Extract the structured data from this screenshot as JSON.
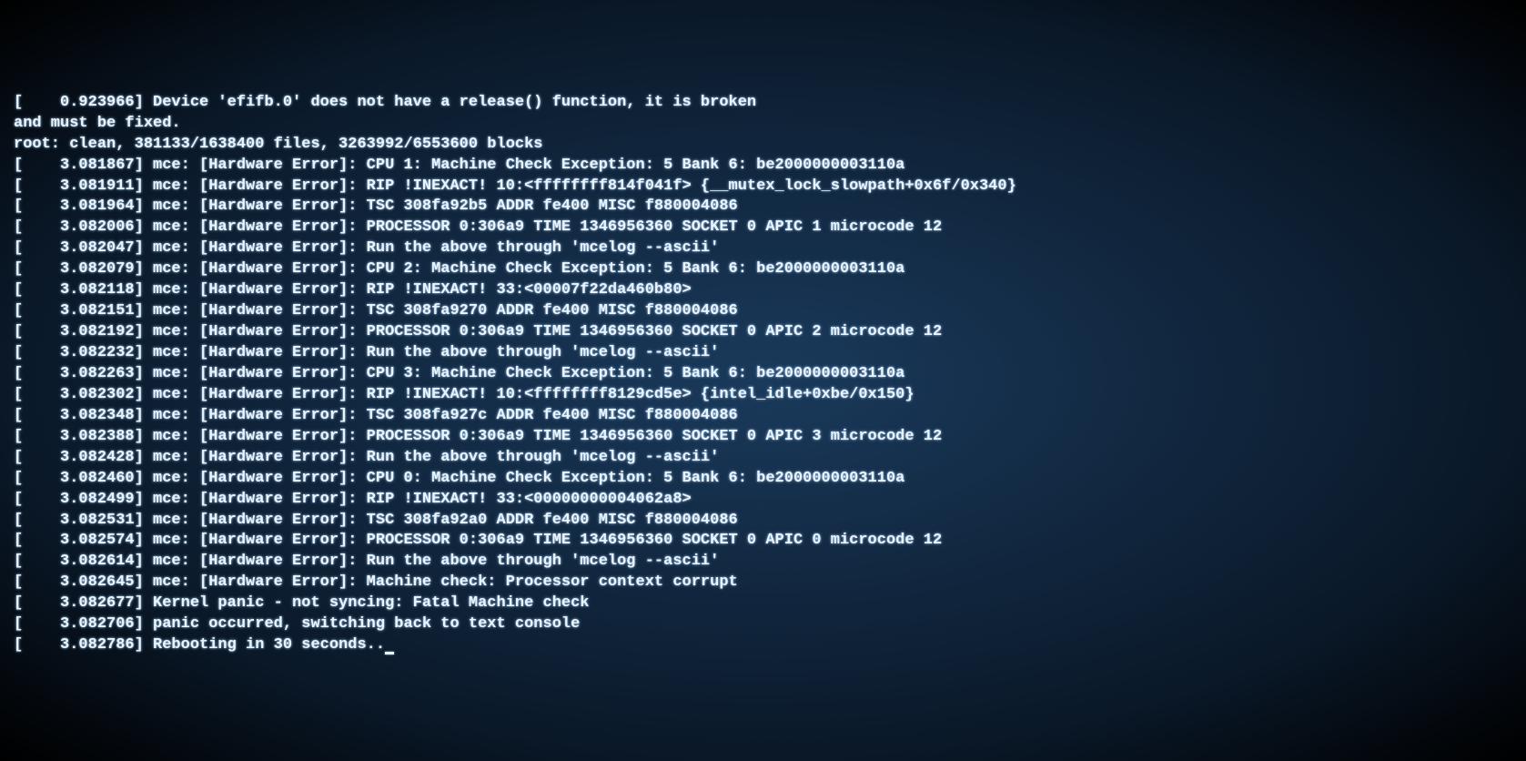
{
  "lines": [
    "[    0.923966] Device 'efifb.0' does not have a release() function, it is broken",
    "and must be fixed.",
    "root: clean, 381133/1638400 files, 3263992/6553600 blocks",
    "[    3.081867] mce: [Hardware Error]: CPU 1: Machine Check Exception: 5 Bank 6: be2000000003110a",
    "[    3.081911] mce: [Hardware Error]: RIP !INEXACT! 10:<ffffffff814f041f> {__mutex_lock_slowpath+0x6f/0x340}",
    "[    3.081964] mce: [Hardware Error]: TSC 308fa92b5 ADDR fe400 MISC f880004086",
    "[    3.082006] mce: [Hardware Error]: PROCESSOR 0:306a9 TIME 1346956360 SOCKET 0 APIC 1 microcode 12",
    "[    3.082047] mce: [Hardware Error]: Run the above through 'mcelog --ascii'",
    "[    3.082079] mce: [Hardware Error]: CPU 2: Machine Check Exception: 5 Bank 6: be2000000003110a",
    "[    3.082118] mce: [Hardware Error]: RIP !INEXACT! 33:<00007f22da460b80>",
    "[    3.082151] mce: [Hardware Error]: TSC 308fa9270 ADDR fe400 MISC f880004086",
    "[    3.082192] mce: [Hardware Error]: PROCESSOR 0:306a9 TIME 1346956360 SOCKET 0 APIC 2 microcode 12",
    "[    3.082232] mce: [Hardware Error]: Run the above through 'mcelog --ascii'",
    "[    3.082263] mce: [Hardware Error]: CPU 3: Machine Check Exception: 5 Bank 6: be2000000003110a",
    "[    3.082302] mce: [Hardware Error]: RIP !INEXACT! 10:<ffffffff8129cd5e> {intel_idle+0xbe/0x150}",
    "[    3.082348] mce: [Hardware Error]: TSC 308fa927c ADDR fe400 MISC f880004086",
    "[    3.082388] mce: [Hardware Error]: PROCESSOR 0:306a9 TIME 1346956360 SOCKET 0 APIC 3 microcode 12",
    "[    3.082428] mce: [Hardware Error]: Run the above through 'mcelog --ascii'",
    "[    3.082460] mce: [Hardware Error]: CPU 0: Machine Check Exception: 5 Bank 6: be2000000003110a",
    "[    3.082499] mce: [Hardware Error]: RIP !INEXACT! 33:<00000000004062a8>",
    "[    3.082531] mce: [Hardware Error]: TSC 308fa92a0 ADDR fe400 MISC f880004086",
    "[    3.082574] mce: [Hardware Error]: PROCESSOR 0:306a9 TIME 1346956360 SOCKET 0 APIC 0 microcode 12",
    "[    3.082614] mce: [Hardware Error]: Run the above through 'mcelog --ascii'",
    "[    3.082645] mce: [Hardware Error]: Machine check: Processor context corrupt",
    "[    3.082677] Kernel panic - not syncing: Fatal Machine check",
    "[    3.082706] panic occurred, switching back to text console",
    "[    3.082786] Rebooting in 30 seconds.."
  ]
}
